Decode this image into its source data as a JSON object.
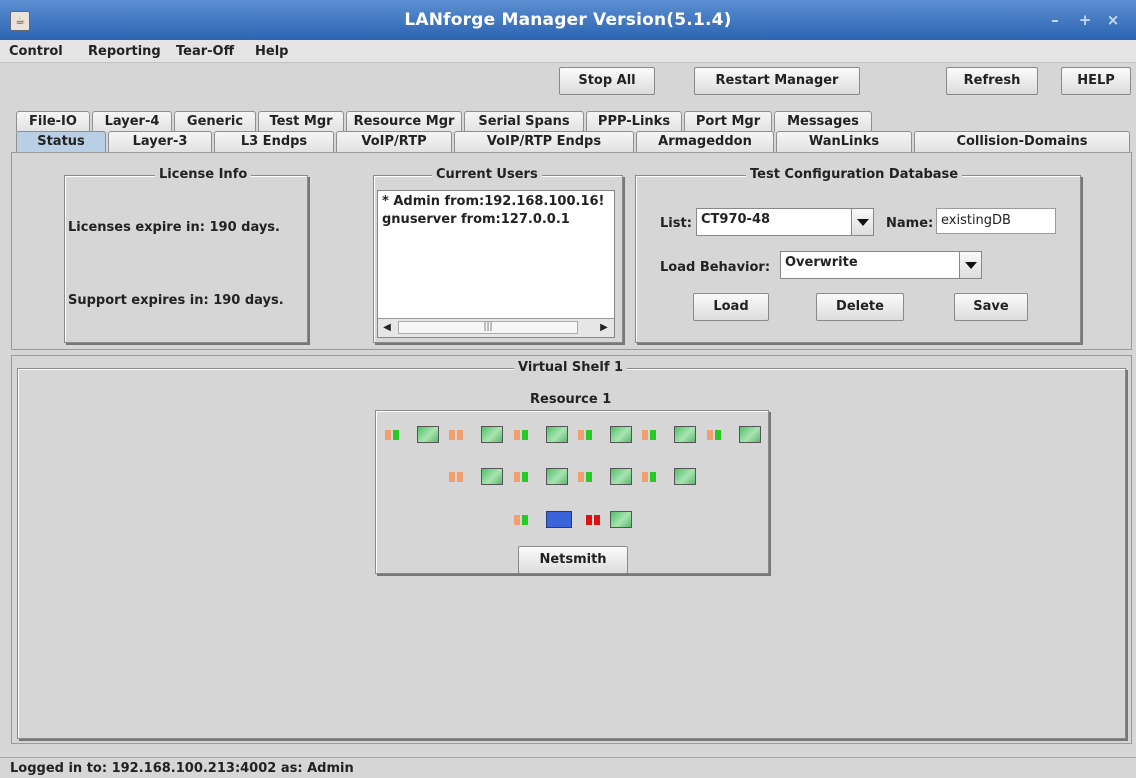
{
  "window": {
    "title": "LANforge Manager   Version(5.1.4)",
    "controls": [
      "minimize-icon",
      "maximize-icon",
      "close-icon"
    ]
  },
  "menu": [
    "Control",
    "Reporting",
    "Tear-Off",
    "Help"
  ],
  "toolbar": {
    "stop_all": "Stop All",
    "restart_manager": "Restart Manager",
    "refresh": "Refresh",
    "help": "HELP"
  },
  "tabs_row1": [
    "File-IO",
    "Layer-4",
    "Generic",
    "Test Mgr",
    "Resource Mgr",
    "Serial Spans",
    "PPP-Links",
    "Port Mgr",
    "Messages"
  ],
  "tabs_row2": [
    "Status",
    "Layer-3",
    "L3 Endps",
    "VoIP/RTP",
    "VoIP/RTP Endps",
    "Armageddon",
    "WanLinks",
    "Collision-Domains"
  ],
  "active_tab": "Status",
  "license": {
    "title": "License Info",
    "licenses_expire": "Licenses expire in: 190 days.",
    "support_expires": "Support expires in: 190 days."
  },
  "current_users": {
    "title": "Current Users",
    "users": [
      "* Admin from:192.168.100.16!",
      "gnuserver from:127.0.0.1"
    ]
  },
  "test_db": {
    "title": "Test Configuration Database",
    "list_label": "List:",
    "list_value": "CT970-48",
    "name_label": "Name:",
    "name_value": "existingDB",
    "load_behavior_label": "Load Behavior:",
    "load_behavior_value": "Overwrite",
    "load": "Load",
    "delete": "Delete",
    "save": "Save"
  },
  "shelf": {
    "title": "Virtual Shelf 1",
    "resource_title": "Resource 1",
    "netsmith": "Netsmith",
    "colors": {
      "led_orange": "#f0a070",
      "led_green": "#22cc22",
      "led_red": "#dd1111",
      "port_blue": "#3b64db"
    }
  },
  "status": {
    "text": "Logged in to:  192.168.100.213:4002  as:  Admin"
  }
}
